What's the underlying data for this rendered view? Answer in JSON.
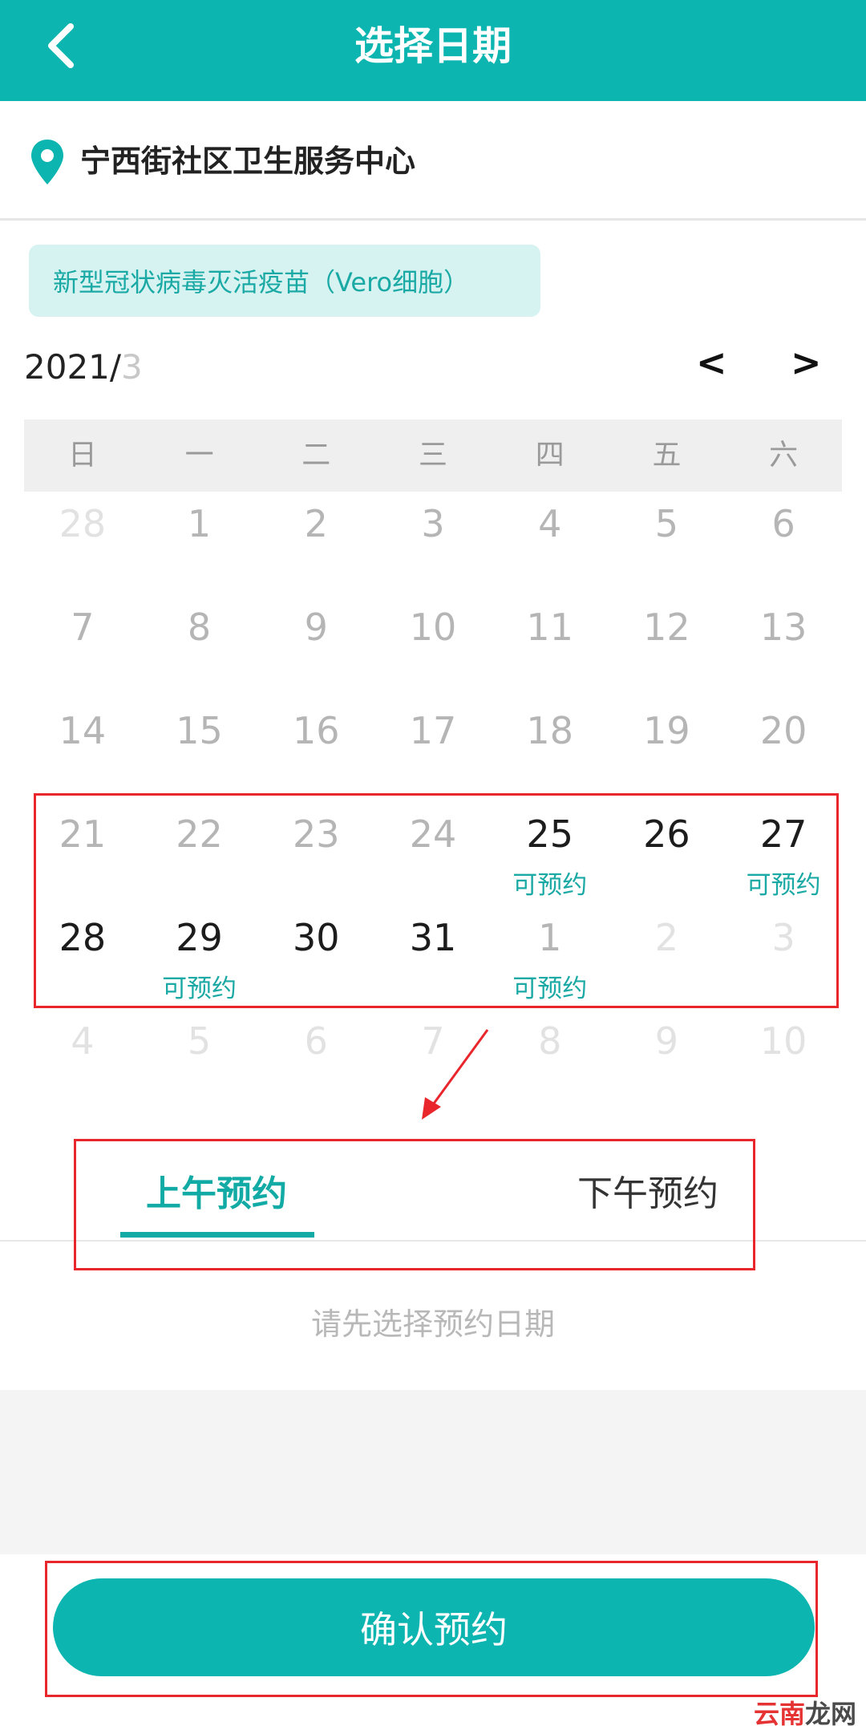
{
  "header": {
    "title": "选择日期"
  },
  "location": {
    "name": "宁西街社区卫生服务中心"
  },
  "vaccine": {
    "label": "新型冠状病毒灭活疫苗（Vero细胞）"
  },
  "calendar": {
    "year_label": "2021/",
    "month_label": "3",
    "prev_label": "<",
    "next_label": ">",
    "weekdays": [
      "日",
      "一",
      "二",
      "三",
      "四",
      "五",
      "六"
    ],
    "days": [
      {
        "n": "28",
        "s": "out",
        "tag": ""
      },
      {
        "n": "1",
        "s": "past",
        "tag": ""
      },
      {
        "n": "2",
        "s": "past",
        "tag": ""
      },
      {
        "n": "3",
        "s": "past",
        "tag": ""
      },
      {
        "n": "4",
        "s": "past",
        "tag": ""
      },
      {
        "n": "5",
        "s": "past",
        "tag": ""
      },
      {
        "n": "6",
        "s": "past",
        "tag": ""
      },
      {
        "n": "7",
        "s": "past",
        "tag": ""
      },
      {
        "n": "8",
        "s": "past",
        "tag": ""
      },
      {
        "n": "9",
        "s": "past",
        "tag": ""
      },
      {
        "n": "10",
        "s": "past",
        "tag": ""
      },
      {
        "n": "11",
        "s": "past",
        "tag": ""
      },
      {
        "n": "12",
        "s": "past",
        "tag": ""
      },
      {
        "n": "13",
        "s": "past",
        "tag": ""
      },
      {
        "n": "14",
        "s": "past",
        "tag": ""
      },
      {
        "n": "15",
        "s": "past",
        "tag": ""
      },
      {
        "n": "16",
        "s": "past",
        "tag": ""
      },
      {
        "n": "17",
        "s": "past",
        "tag": ""
      },
      {
        "n": "18",
        "s": "past",
        "tag": ""
      },
      {
        "n": "19",
        "s": "past",
        "tag": ""
      },
      {
        "n": "20",
        "s": "past",
        "tag": ""
      },
      {
        "n": "21",
        "s": "past",
        "tag": ""
      },
      {
        "n": "22",
        "s": "past",
        "tag": ""
      },
      {
        "n": "23",
        "s": "past",
        "tag": ""
      },
      {
        "n": "24",
        "s": "past",
        "tag": ""
      },
      {
        "n": "25",
        "s": "avail",
        "tag": "可预约"
      },
      {
        "n": "26",
        "s": "avail",
        "tag": ""
      },
      {
        "n": "27",
        "s": "avail",
        "tag": "可预约"
      },
      {
        "n": "28",
        "s": "avail",
        "tag": ""
      },
      {
        "n": "29",
        "s": "avail",
        "tag": "可预约"
      },
      {
        "n": "30",
        "s": "avail",
        "tag": ""
      },
      {
        "n": "31",
        "s": "avail",
        "tag": ""
      },
      {
        "n": "1",
        "s": "past",
        "tag": "可预约"
      },
      {
        "n": "2",
        "s": "out",
        "tag": ""
      },
      {
        "n": "3",
        "s": "out",
        "tag": ""
      },
      {
        "n": "4",
        "s": "out",
        "tag": ""
      },
      {
        "n": "5",
        "s": "out",
        "tag": ""
      },
      {
        "n": "6",
        "s": "out",
        "tag": ""
      },
      {
        "n": "7",
        "s": "out",
        "tag": ""
      },
      {
        "n": "8",
        "s": "out",
        "tag": ""
      },
      {
        "n": "9",
        "s": "out",
        "tag": ""
      },
      {
        "n": "10",
        "s": "out",
        "tag": ""
      }
    ]
  },
  "period": {
    "am_label": "上午预约",
    "pm_label": "下午预约"
  },
  "hint": "请先选择预约日期",
  "confirm_label": "确认预约",
  "watermark": {
    "part1": "云南",
    "part2": "龙网"
  },
  "colors": {
    "accent": "#0cb5b0",
    "annotation": "#e8262c"
  }
}
